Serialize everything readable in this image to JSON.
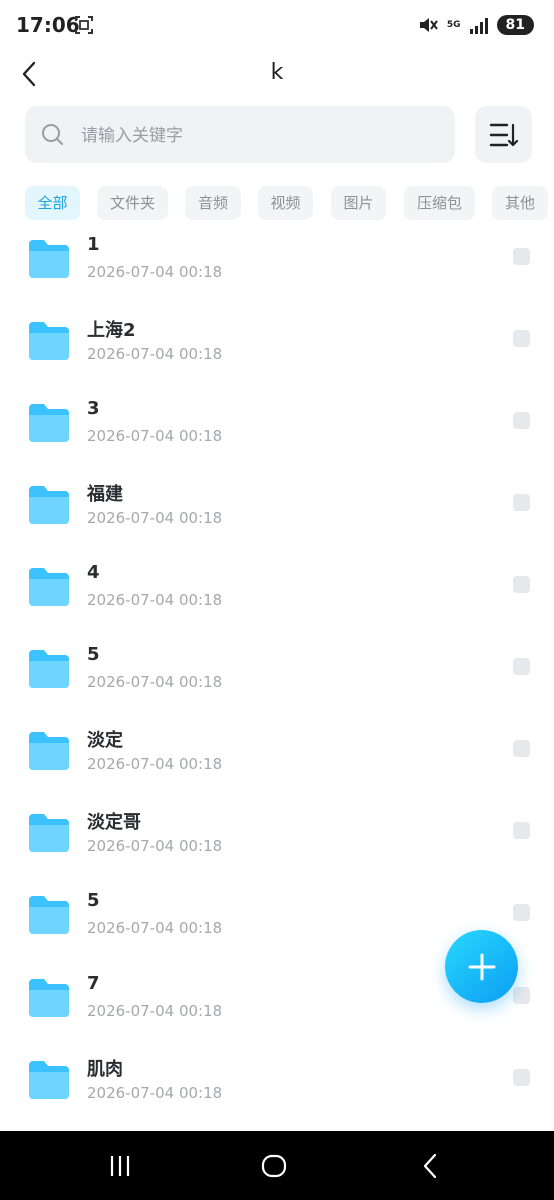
{
  "status_bar": {
    "time": "17:06",
    "network": "5G",
    "battery": "81"
  },
  "header": {
    "title": "k"
  },
  "search": {
    "placeholder": "请输入关键字"
  },
  "filters": [
    {
      "label": "全部",
      "active": true
    },
    {
      "label": "文件夹",
      "active": false
    },
    {
      "label": "音频",
      "active": false
    },
    {
      "label": "视频",
      "active": false
    },
    {
      "label": "图片",
      "active": false
    },
    {
      "label": "压缩包",
      "active": false
    },
    {
      "label": "其他",
      "active": false
    }
  ],
  "files": [
    {
      "name": "1",
      "date": "2026-07-04 00:18"
    },
    {
      "name": "上海2",
      "date": "2026-07-04 00:18"
    },
    {
      "name": "3",
      "date": "2026-07-04 00:18"
    },
    {
      "name": "福建",
      "date": "2026-07-04 00:18"
    },
    {
      "name": "4",
      "date": "2026-07-04 00:18"
    },
    {
      "name": "5",
      "date": "2026-07-04 00:18"
    },
    {
      "name": "淡定",
      "date": "2026-07-04 00:18"
    },
    {
      "name": "淡定哥",
      "date": "2026-07-04 00:18"
    },
    {
      "name": "5",
      "date": "2026-07-04 00:18"
    },
    {
      "name": "7",
      "date": "2026-07-04 00:18"
    },
    {
      "name": "肌肉",
      "date": "2026-07-04 00:18"
    }
  ],
  "colors": {
    "accent": "#1aa3dc",
    "folder": "#3cc3ff",
    "fab": "#0c9df2"
  },
  "icons": {
    "back": "chevron-left-icon",
    "sort": "sort-icon",
    "add": "plus-icon",
    "folder": "folder-icon"
  }
}
